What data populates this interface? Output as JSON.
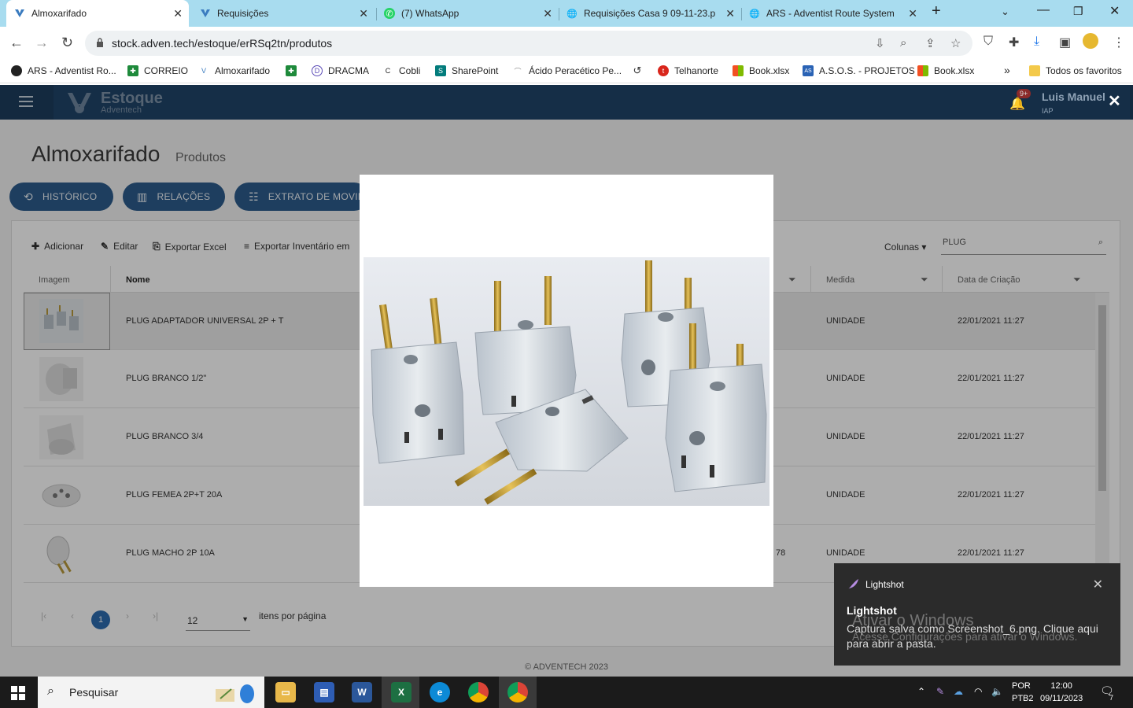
{
  "browser": {
    "tabs": [
      {
        "label": "Almoxarifado",
        "active": true,
        "icon": "adventech-icon"
      },
      {
        "label": "Requisições",
        "active": false,
        "icon": "adventech-icon"
      },
      {
        "label": "(7) WhatsApp",
        "active": false,
        "icon": "whatsapp-icon"
      },
      {
        "label": "Requisições Casa 9 09-11-23.p",
        "active": false,
        "icon": "globe-icon"
      },
      {
        "label": "ARS - Adventist Route System",
        "active": false,
        "icon": "globe-icon"
      }
    ],
    "url": "stock.adven.tech/estoque/erRSq2tn/produtos",
    "bookmarks": [
      "ARS - Adventist Ro...",
      "CORREIO",
      "Almoxarifado",
      "",
      "DRACMA",
      "Cobli",
      "SharePoint",
      "Ácido Peracético Pe...",
      "",
      "Telhanorte",
      "Book.xlsx",
      "A.S.O.S. - PROJETOS",
      "Book.xlsx"
    ],
    "all_bookmarks": "Todos os favoritos",
    "more": "»"
  },
  "app": {
    "brand": "Estoque",
    "brand_sub": "Adventech",
    "badge": "9+",
    "user_name": "Luis Manuel",
    "user_role": "IAP",
    "page_title": "Almoxarifado",
    "page_subtitle": "Produtos",
    "pills": [
      "HISTÓRICO",
      "RELAÇÕES",
      "EXTRATO DE MOVIM"
    ],
    "toolbar": {
      "add": "Adicionar",
      "edit": "Editar",
      "export_excel": "Exportar Excel",
      "export_inventory": "Exportar Inventário em"
    },
    "columns_label": "Colunas",
    "search_value": "PLUG",
    "headers": {
      "image": "Imagem",
      "name": "Nome",
      "measure": "Medida",
      "created": "Data de Criação"
    },
    "rows": [
      {
        "name": "PLUG ADAPTADOR UNIVERSAL 2P + T",
        "extra": "",
        "measure": "UNIDADE",
        "date": "22/01/2021 11:27"
      },
      {
        "name": "PLUG BRANCO 1/2\"",
        "extra": "",
        "measure": "UNIDADE",
        "date": "22/01/2021 11:27"
      },
      {
        "name": "PLUG BRANCO 3/4",
        "extra": "",
        "measure": "UNIDADE",
        "date": "22/01/2021 11:27"
      },
      {
        "name": "PLUG FEMEA 2P+T 20A",
        "extra": "",
        "measure": "UNIDADE",
        "date": "22/01/2021 11:27"
      },
      {
        "name": "PLUG MACHO 2P 10A",
        "extra": "78",
        "measure": "UNIDADE",
        "date": "22/01/2021 11:27"
      }
    ],
    "pager": {
      "current": "1",
      "per_page": "12",
      "per_page_label": "itens por página"
    },
    "footer": "© ADVENTECH 2023"
  },
  "toast": {
    "app": "Lightshot",
    "title": "Lightshot",
    "body": "Captura salva como Screenshot_6.png. Clique aqui para abrir a pasta.",
    "watermark_1": "Ativar o Windows",
    "watermark_2": "Acesse Configurações para ativar o Windows."
  },
  "taskbar": {
    "search": "Pesquisar",
    "lang_1": "POR",
    "lang_2": "PTB2",
    "time": "12:00",
    "date": "09/11/2023",
    "notifications": "7"
  },
  "colors": {
    "accent": "#2d5c8c",
    "header": "#1f4469",
    "tabstrip": "#a8dcef"
  }
}
